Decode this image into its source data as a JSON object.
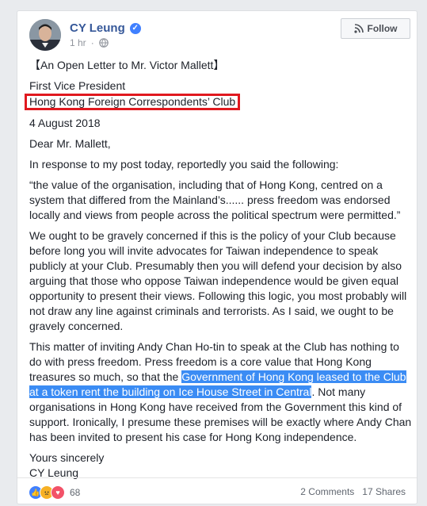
{
  "post": {
    "author": "CY Leung",
    "time": "1 hr",
    "follow_label": "Follow",
    "paragraphs": {
      "title": "【An Open Letter to Mr. Victor Mallett】",
      "role": "First Vice President",
      "org": "Hong Kong Foreign Correspondents’ Club",
      "date": "4 August 2018",
      "salutation": "Dear Mr. Mallett,",
      "p1": "In response to my post today, reportedly you said the following:",
      "p2": "“the value of the organisation, including that of Hong Kong, centred on a system that differed from the Mainland’s...... press freedom was endorsed locally and views from people across the political spectrum were permitted.”",
      "p3": "We ought to be gravely concerned if this is the policy of your Club because before long you will invite advocates for Taiwan independence to speak publicly at your Club. Presumably then you will defend your decision by also arguing that those who oppose Taiwan independence would be given equal opportunity to present their views. Following this logic, you most probably will not draw any line against criminals and terrorists. As I said, we ought to be gravely concerned.",
      "p4_before": "This matter of inviting Andy Chan Ho-tin to speak at the Club has nothing to do with press freedom. Press freedom is a core value that Hong Kong treasures so much, so that the ",
      "p4_highlight": "Government of Hong Kong leased to the Club at a token rent the building on Ice House Street in Central",
      "p4_after": ". Not many organisations in Hong Kong have received from the Government this kind of support. Ironically, I presume these premises will be exactly where Andy Chan has been invited to present his case for Hong Kong independence.",
      "closing": "Yours sincerely",
      "signature": "CY Leung"
    }
  },
  "footer": {
    "reaction_count": "68",
    "comments": "2 Comments",
    "shares": "17 Shares"
  },
  "colors": {
    "author_link": "#365899",
    "highlight": "#3b8cf4",
    "annotation_box": "#e0191f"
  }
}
